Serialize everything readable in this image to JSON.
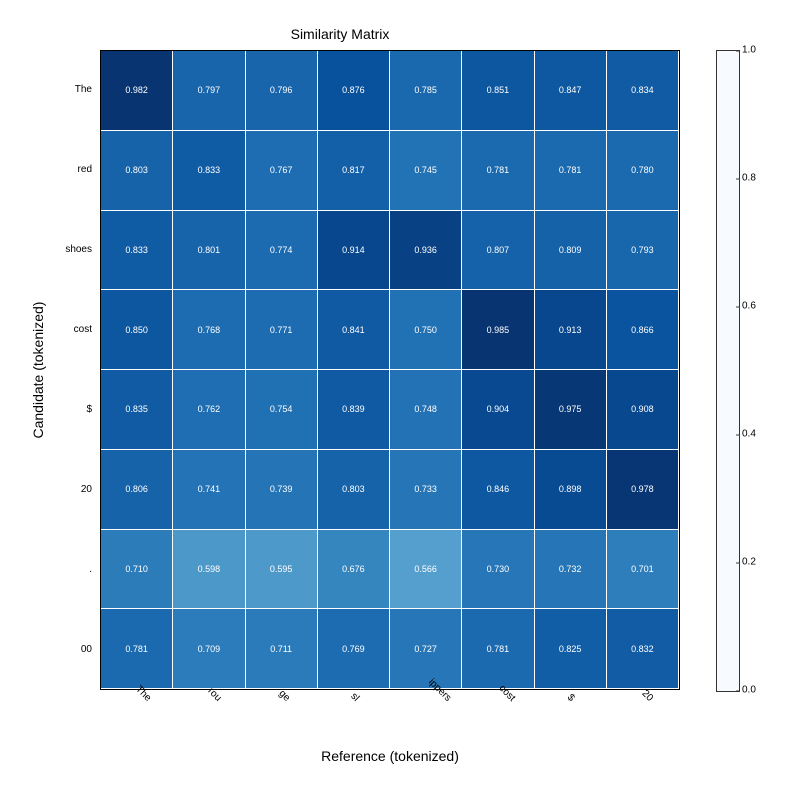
{
  "chart_data": {
    "type": "heatmap",
    "title": "Similarity Matrix",
    "xlabel": "Reference (tokenized)",
    "ylabel": "Candidate (tokenized)",
    "x_categories": [
      "The",
      "rou",
      "ge",
      "sl",
      "ippers",
      "cost",
      "$",
      "20"
    ],
    "y_categories": [
      "The",
      "red",
      "shoes",
      "cost",
      "$",
      "20",
      ".",
      "00"
    ],
    "values": [
      [
        0.982,
        0.797,
        0.796,
        0.876,
        0.785,
        0.851,
        0.847,
        0.834
      ],
      [
        0.803,
        0.833,
        0.767,
        0.817,
        0.745,
        0.781,
        0.781,
        0.78
      ],
      [
        0.833,
        0.801,
        0.774,
        0.914,
        0.936,
        0.807,
        0.809,
        0.793
      ],
      [
        0.85,
        0.768,
        0.771,
        0.841,
        0.75,
        0.985,
        0.913,
        0.866
      ],
      [
        0.835,
        0.762,
        0.754,
        0.839,
        0.748,
        0.904,
        0.975,
        0.908
      ],
      [
        0.806,
        0.741,
        0.739,
        0.803,
        0.733,
        0.846,
        0.898,
        0.978
      ],
      [
        0.71,
        0.598,
        0.595,
        0.676,
        0.566,
        0.73,
        0.732,
        0.701
      ],
      [
        0.781,
        0.709,
        0.711,
        0.769,
        0.727,
        0.781,
        0.825,
        0.832
      ]
    ],
    "vmin": 0.0,
    "vmax": 1.0,
    "colorbar_ticks": [
      "0.0",
      "0.2",
      "0.4",
      "0.6",
      "0.8",
      "1.0"
    ],
    "cmap": "Blues"
  }
}
